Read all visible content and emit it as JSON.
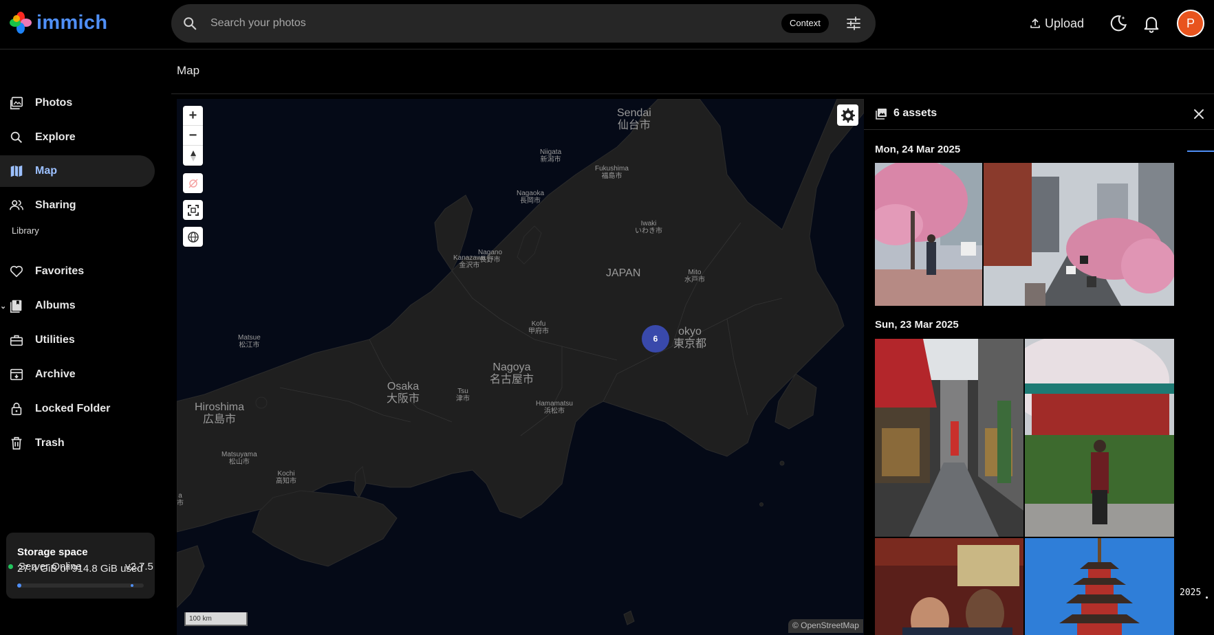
{
  "app": {
    "name": "immich",
    "colors": {
      "accent": "#4f8ff7",
      "avatar": "#e8541e",
      "cluster": "#3949ab",
      "online": "#22c55e"
    }
  },
  "topbar": {
    "search_placeholder": "Search your photos",
    "context_label": "Context",
    "upload_label": "Upload",
    "avatar_initial": "P"
  },
  "sidebar": {
    "items": [
      {
        "label": "Photos",
        "icon": "photos-icon"
      },
      {
        "label": "Explore",
        "icon": "search-icon"
      },
      {
        "label": "Map",
        "icon": "map-icon",
        "active": true
      },
      {
        "label": "Sharing",
        "icon": "people-icon"
      }
    ],
    "library_label": "Library",
    "library_items": [
      {
        "label": "Favorites",
        "icon": "heart-icon"
      },
      {
        "label": "Albums",
        "icon": "album-icon"
      },
      {
        "label": "Utilities",
        "icon": "toolbox-icon"
      },
      {
        "label": "Archive",
        "icon": "archive-icon"
      },
      {
        "label": "Locked Folder",
        "icon": "lock-icon"
      },
      {
        "label": "Trash",
        "icon": "trash-icon"
      }
    ],
    "storage": {
      "title": "Storage space",
      "used_text": "27.4 GiB of 914.8 GiB used",
      "used_fraction": 0.03
    },
    "server_status": "Server Online",
    "version": "v2.7.5"
  },
  "page": {
    "title": "Map"
  },
  "map": {
    "cluster_count": "6",
    "scale_label": "100 km",
    "attribution": "© OpenStreetMap",
    "labels": [
      {
        "text": "Sendai",
        "sub": "仙台市",
        "size": "big"
      },
      {
        "text": "Niigata",
        "sub": "新潟市",
        "size": "small"
      },
      {
        "text": "Fukushima",
        "sub": "福島市",
        "size": "small"
      },
      {
        "text": "Nagaoka",
        "sub": "長岡市",
        "size": "small"
      },
      {
        "text": "Iwaki",
        "sub": "いわき市",
        "size": "small"
      },
      {
        "text": "Kanazawa",
        "sub": "金沢市",
        "size": "small"
      },
      {
        "text": "Nagano",
        "sub": "長野市",
        "size": "small"
      },
      {
        "text": "JAPAN",
        "sub": "",
        "size": "big"
      },
      {
        "text": "Mito",
        "sub": "水戸市",
        "size": "small"
      },
      {
        "text": "Matsue",
        "sub": "松江市",
        "size": "small"
      },
      {
        "text": "Kofu",
        "sub": "甲府市",
        "size": "small"
      },
      {
        "text": "okyo",
        "sub": "東京都",
        "size": "big"
      },
      {
        "text": "Nagoya",
        "sub": "名古屋市",
        "size": "big"
      },
      {
        "text": "Osaka",
        "sub": "大阪市",
        "size": "big"
      },
      {
        "text": "Hiroshima",
        "sub": "広島市",
        "size": "big"
      },
      {
        "text": "Tsu",
        "sub": "津市",
        "size": "small"
      },
      {
        "text": "Hamamatsu",
        "sub": "浜松市",
        "size": "small"
      },
      {
        "text": "Matsuyama",
        "sub": "松山市",
        "size": "small"
      },
      {
        "text": "Kochi",
        "sub": "高知市",
        "size": "small"
      },
      {
        "text": "a",
        "sub": "市",
        "size": "small"
      }
    ]
  },
  "panel": {
    "assets_count": "6 assets",
    "groups": [
      {
        "date": "Mon, 24 Mar 2025"
      },
      {
        "date": "Sun, 23 Mar 2025"
      }
    ],
    "scrubber_year": "2025"
  }
}
